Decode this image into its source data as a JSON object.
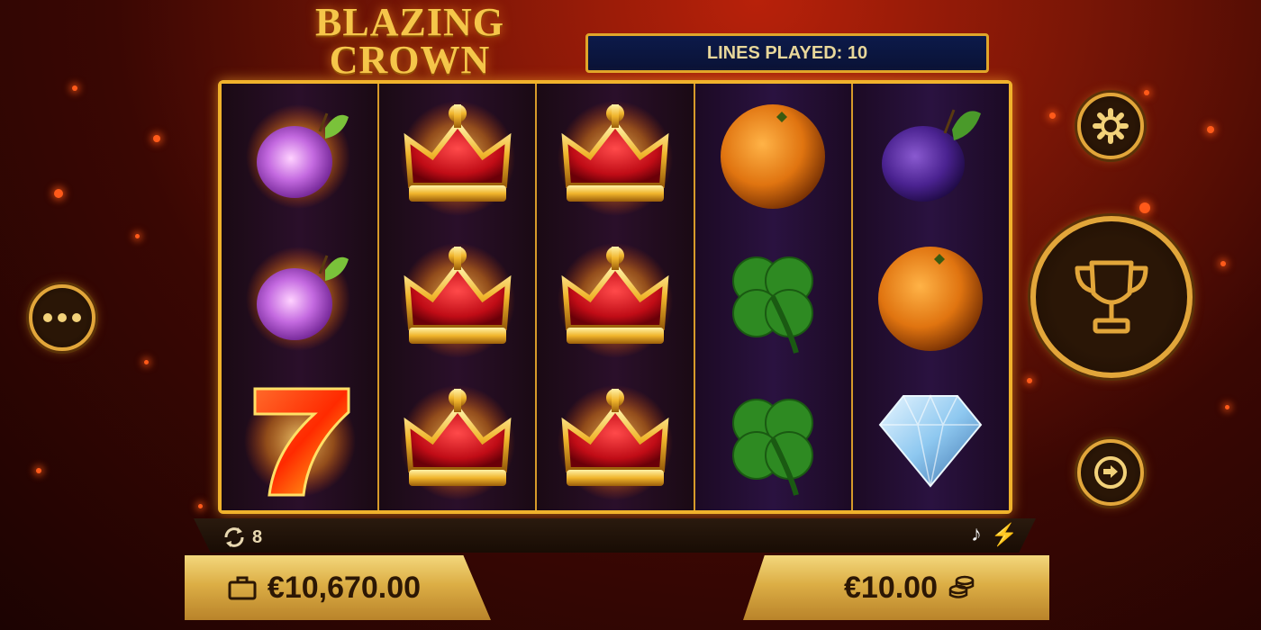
{
  "game": {
    "logo_line1": "BLAZING",
    "logo_line2": "CROWN"
  },
  "header": {
    "lines_played": "LINES PLAYED: 10"
  },
  "reels": [
    [
      "plum-fire",
      "plum-fire",
      "seven-fire"
    ],
    [
      "crown",
      "crown",
      "crown"
    ],
    [
      "crown",
      "crown",
      "crown"
    ],
    [
      "orange",
      "clover",
      "clover"
    ],
    [
      "plum",
      "orange",
      "diamond"
    ]
  ],
  "footer": {
    "free_spins_count": "8",
    "balance": "€10,670.00",
    "bet": "€10.00"
  },
  "controls": {
    "left": [
      "more-menu-button"
    ],
    "right": [
      "settings-button",
      "trophy-spin-button",
      "autoplay-button"
    ],
    "strip": [
      "music-note-icon",
      "lightning-icon"
    ]
  },
  "colors": {
    "gold": "#f0b22c",
    "panel_gold": "#dcae45",
    "header_navy": "#0c1a4a",
    "background_red": "#b8210a"
  }
}
